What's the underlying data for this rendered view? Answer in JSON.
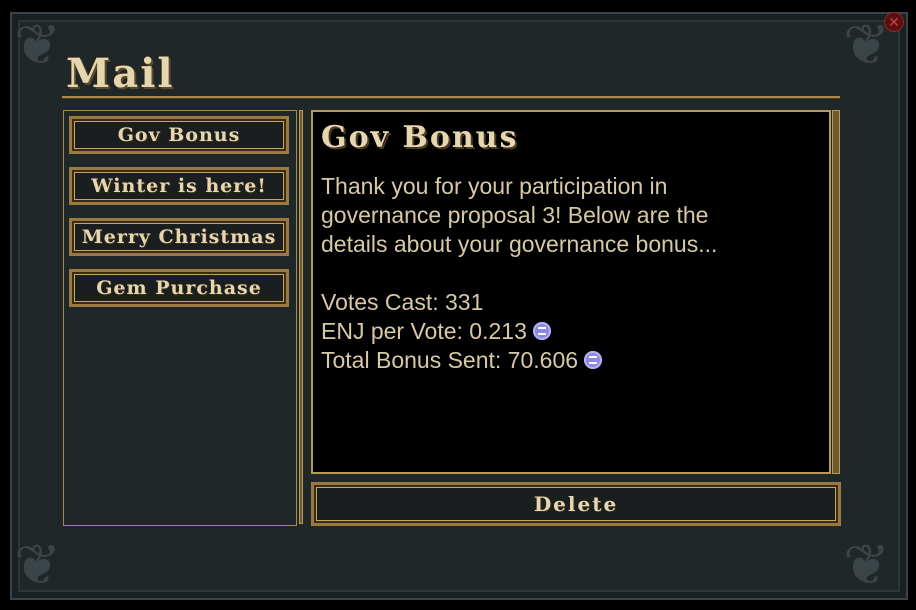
{
  "window": {
    "title": "Mail",
    "close_icon": "close-icon"
  },
  "mail_list": {
    "items": [
      {
        "label": "Gov Bonus"
      },
      {
        "label": "Winter is here!"
      },
      {
        "label": "Merry Christmas"
      },
      {
        "label": "Gem Purchase"
      }
    ]
  },
  "message": {
    "title": "Gov Bonus",
    "body_lines": [
      "Thank you for your participation in",
      "governance proposal 3! Below are the",
      "details about your governance bonus..."
    ],
    "votes_cast": "Votes Cast: 331",
    "enj_per_vote": "ENJ per Vote: 0.213",
    "total_bonus": "Total Bonus Sent: 70.606",
    "currency_icon": "enj-coin-icon"
  },
  "actions": {
    "delete_label": "Delete"
  },
  "colors": {
    "gold_border": "#b89a58",
    "text_parchment": "#e6d6b0",
    "panel_bg": "#1f2729",
    "enj_icon": "#8a88e0"
  }
}
